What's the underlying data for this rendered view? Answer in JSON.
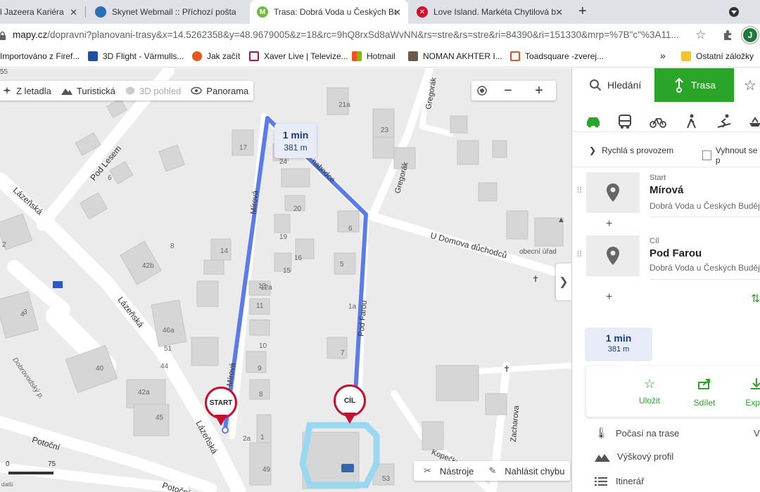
{
  "tabs": [
    {
      "title": "l Jazeera Kariéra",
      "fav_color": "#e2a400"
    },
    {
      "title": "Skynet Webmail :: Příchozí pošta",
      "fav_color": "#2a6fb5"
    },
    {
      "title": "Trasa: Dobrá Voda u Českých Bud",
      "fav_color": "#6fb93f"
    },
    {
      "title": "Love Island. Markéta Chytilová b",
      "fav_color": "#d0112b"
    }
  ],
  "tab_close": "✕",
  "new_tab": "+",
  "address": {
    "host": "mapy.cz",
    "path": "/dopravni?planovani-trasy&x=14.5262358&y=48.9679005&z=18&rc=9hQ8rxSd8aWvNN&rs=stre&rs=stre&ri=84390&ri=151330&mrp=%7B\"c\"%3A11..."
  },
  "profile_initial": "J",
  "bookmarks": [
    {
      "label": "Importováno z Firef..."
    },
    {
      "label": "3D Flight - Värmulls..."
    },
    {
      "label": "Jak začít"
    },
    {
      "label": "Xaver Live | Televize..."
    },
    {
      "label": "Hotmail"
    },
    {
      "label": "NOMAN AKHTER I..."
    },
    {
      "label": "Toadsquare -zverej..."
    }
  ],
  "bookmarks_more": "»",
  "bookmarks_other": "Ostatní záložky",
  "map": {
    "toolbar": {
      "flights": "Z letadla",
      "tourist": "Turistická",
      "view3d": "3D pohled",
      "panorama": "Panorama"
    },
    "zoom_out": "−",
    "zoom_in": "+",
    "route_bubble": {
      "time": "1 min",
      "distance": "381 m"
    },
    "start_label": "START",
    "end_label": "CÍL",
    "streets": [
      {
        "name": "Pod Lesem"
      },
      {
        "name": "Lázeňská"
      },
      {
        "name": "Lázeňská"
      },
      {
        "name": "Lázeňská"
      },
      {
        "name": "Mírová"
      },
      {
        "name": "Mírová"
      },
      {
        "name": "Pod Farou"
      },
      {
        "name": "Gregorák"
      },
      {
        "name": "Gregorák"
      },
      {
        "name": "U Domova důchodců"
      },
      {
        "name": "Potoční"
      },
      {
        "name": "Potoční"
      },
      {
        "name": "Zacharova"
      },
      {
        "name": "Kopečku"
      },
      {
        "name": "Dobrovodský p."
      },
      {
        "name": "nabodce"
      }
    ],
    "poi_label": "obecní úřad",
    "house_numbers": [
      "17",
      "8",
      "6",
      "24",
      "23",
      "21a",
      "20",
      "19",
      "16",
      "15",
      "14",
      "13",
      "12a",
      "11",
      "10",
      "9",
      "8",
      "7",
      "6",
      "5",
      "1a",
      "1",
      "2a",
      "2",
      "3",
      "4",
      "40",
      "42b",
      "42a",
      "45",
      "46a",
      "44",
      "51",
      "49",
      "53",
      "55",
      "5"
    ],
    "tools": {
      "tools_label": "Nástroje",
      "report_label": "Nahlásit chybu"
    },
    "scale": {
      "v0": "0",
      "v1": "75",
      "small": "další"
    }
  },
  "sidebar": {
    "search_label": "Hledání",
    "route_label": "Trasa",
    "traffic_label": "Rychlá s provozem",
    "avoid_label": "Vyhnout se p",
    "start": {
      "label": "Start",
      "name": "Mírová",
      "place": "Dobrá Voda u Českých Budějo"
    },
    "end": {
      "label": "Cíl",
      "name": "Pod Farou",
      "place": "Dobrá Voda u Českých Budějo"
    },
    "add_label": "+",
    "summary": {
      "time": "1 min",
      "distance": "381 m"
    },
    "actions": {
      "save": "Uložit",
      "share": "Sdílet",
      "export": "Expor"
    },
    "weather_label": "Počasí na trase",
    "weather_extra": "V",
    "elevation_label": "Výškový profil",
    "itinerary_label": "Itinerář"
  },
  "colors": {
    "accent_green": "#2aa52a",
    "route_blue": "#5b7be8",
    "pin_red": "#c8102e"
  }
}
